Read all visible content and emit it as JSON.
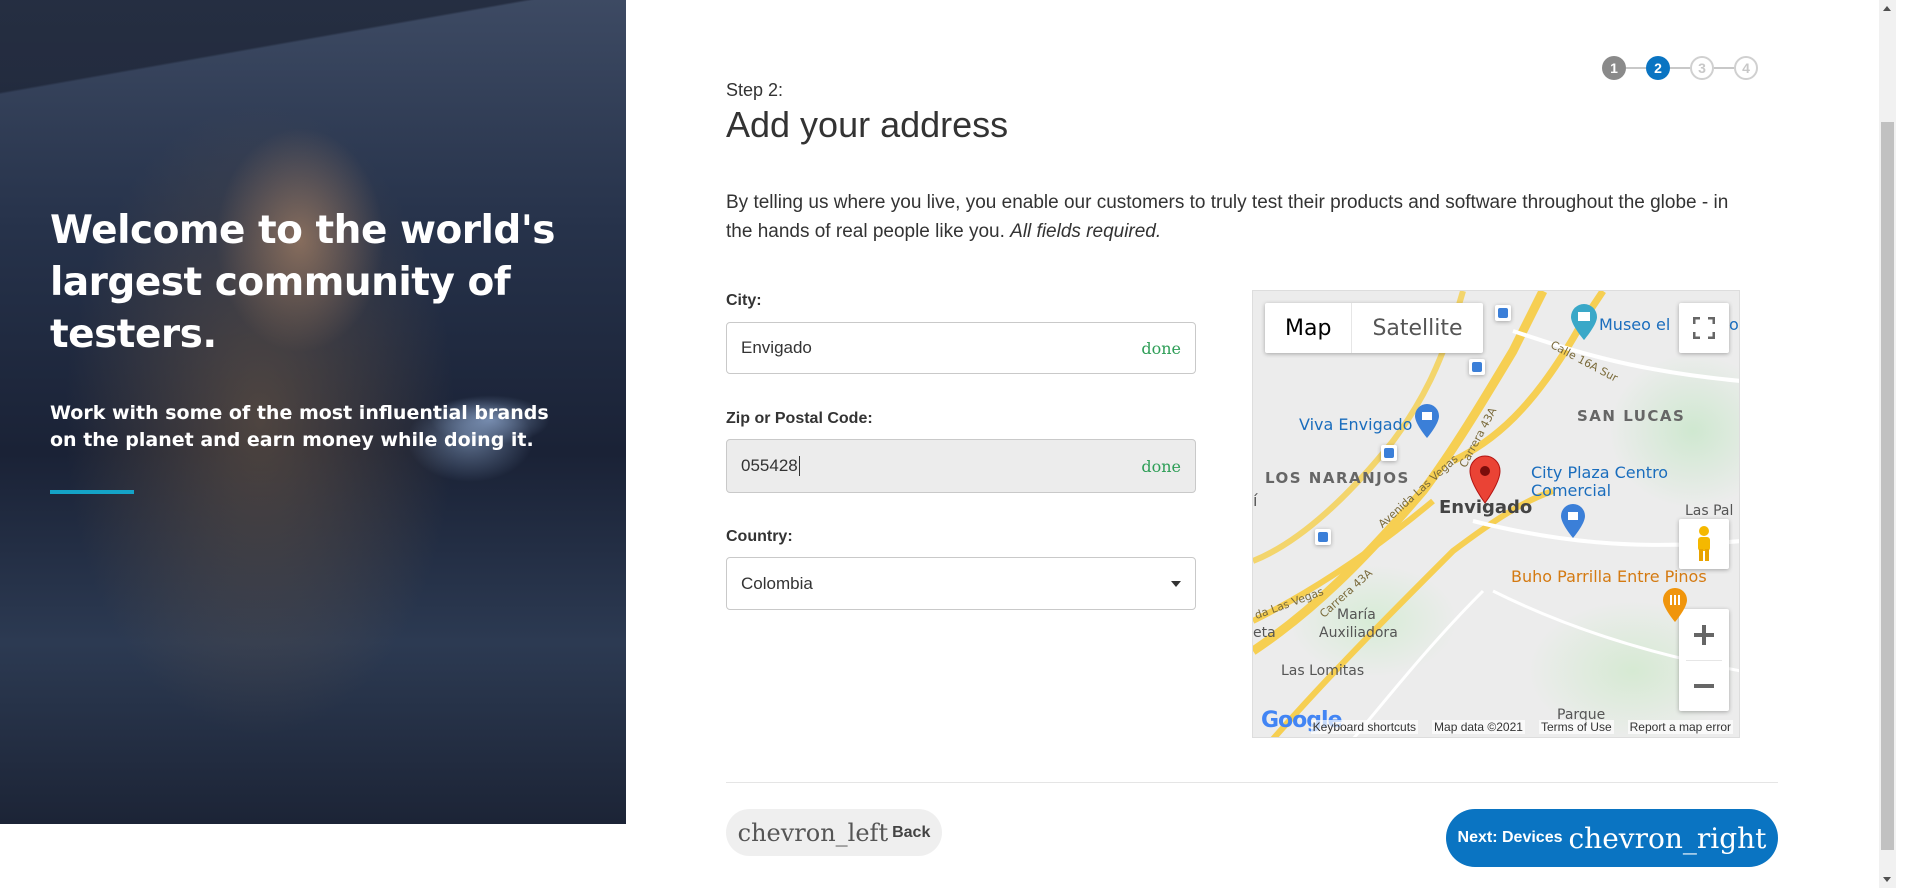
{
  "hero": {
    "title": "Welcome to the world's largest community of testers.",
    "subtitle": "Work with some of the most influential brands on the planet and earn money while doing it."
  },
  "steps": [
    "1",
    "2",
    "3",
    "4"
  ],
  "form": {
    "step_label": "Step 2:",
    "title": "Add your address",
    "intro": "By telling us where you live, you enable our customers to truly test their products and software throughout the globe - in the hands of real people like you.",
    "intro_required": "All fields required.",
    "city": {
      "label": "City:",
      "value": "Envigado",
      "status": "done"
    },
    "zip": {
      "label": "Zip or Postal Code:",
      "value": "055428",
      "status": "done"
    },
    "country": {
      "label": "Country:",
      "value": "Colombia"
    }
  },
  "map": {
    "type_map": "Map",
    "type_satellite": "Satellite",
    "labels": {
      "museo": "Museo el",
      "museo_o": "o",
      "calle": "Calle 16A Sur",
      "viva": "Viva Envigado",
      "san_lucas": "SAN LUCAS",
      "carrera_43a_top": "Carrera 43A",
      "los_naranjos": "LOS NARANJOS",
      "avenida": "Avenida Las Vegas",
      "city_plaza": "City Plaza Centro",
      "comercial": "Comercial",
      "envigado": "Envigado",
      "las_pal": "Las Pal",
      "i_acute": "í",
      "carrera_43a_bottom": "Carrera 43A",
      "buho": "Buho Parrilla Entre Pinos",
      "las_vegas": "da Las Vegas",
      "eta": "eta",
      "maria": "María",
      "auxiliadora": "Auxiliadora",
      "las_lomitas": "Las Lomitas",
      "parque": "Parque"
    },
    "google": "Google",
    "footer": {
      "shortcuts": "Keyboard shortcuts",
      "data": "Map data ©2021",
      "terms": "Terms of Use",
      "report": "Report a map error"
    }
  },
  "buttons": {
    "back_icon": "chevron_left",
    "back": "Back",
    "next": "Next: Devices",
    "next_icon": "chevron_right"
  },
  "colors": {
    "primary": "#0a74c2",
    "accent_bar": "#14a3c7",
    "done_text": "#2e9e57"
  }
}
